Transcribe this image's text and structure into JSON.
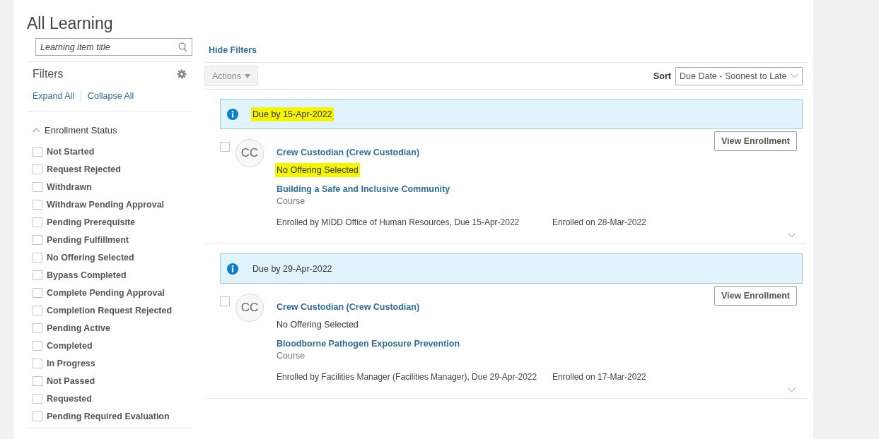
{
  "page": {
    "title": "All Learning"
  },
  "search": {
    "placeholder": "Learning item title"
  },
  "filters": {
    "title": "Filters",
    "expand_all": "Expand All",
    "collapse_all": "Collapse All",
    "sections": [
      {
        "title": "Enrollment Status",
        "expanded": true,
        "options": [
          {
            "label": "Not Started",
            "checked": false
          },
          {
            "label": "Request Rejected",
            "checked": false
          },
          {
            "label": "Withdrawn",
            "checked": false
          },
          {
            "label": "Withdraw Pending Approval",
            "checked": false
          },
          {
            "label": "Pending Prerequisite",
            "checked": false
          },
          {
            "label": "Pending Fulfillment",
            "checked": false
          },
          {
            "label": "No Offering Selected",
            "checked": false
          },
          {
            "label": "Bypass Completed",
            "checked": false
          },
          {
            "label": "Complete Pending Approval",
            "checked": false
          },
          {
            "label": "Completion Request Rejected",
            "checked": false
          },
          {
            "label": "Pending Active",
            "checked": false
          },
          {
            "label": "Completed",
            "checked": false
          },
          {
            "label": "In Progress",
            "checked": false
          },
          {
            "label": "Not Passed",
            "checked": false
          },
          {
            "label": "Requested",
            "checked": false
          },
          {
            "label": "Pending Required Evaluation",
            "checked": false
          }
        ]
      }
    ]
  },
  "hide_filters": "Hide Filters",
  "toolbar": {
    "actions": "Actions",
    "sort_label": "Sort",
    "sort_value": "Due Date - Soonest to Late"
  },
  "groups": [
    {
      "due": "Due by 15-Apr-2022",
      "highlighted": true,
      "items": [
        {
          "initials": "CC",
          "checked": false,
          "assignee": "Crew Custodian (Crew Custodian)",
          "status": "No Offering Selected",
          "status_highlighted": true,
          "title": "Building a Safe and Inclusive Community",
          "type": "Course",
          "enrolled_by": "Enrolled by MIDD Office of Human Resources, Due 15-Apr-2022",
          "enrolled_on": "Enrolled on 28-Mar-2022",
          "button": "View Enrollment",
          "expanded": false
        }
      ]
    },
    {
      "due": "Due by 29-Apr-2022",
      "highlighted": false,
      "items": [
        {
          "initials": "CC",
          "checked": false,
          "assignee": "Crew Custodian (Crew Custodian)",
          "status": "No Offering Selected",
          "status_highlighted": false,
          "title": "Bloodborne Pathogen Exposure Prevention",
          "type": "Course",
          "enrolled_by": "Enrolled by Facilities Manager (Facilities Manager), Due 29-Apr-2022",
          "enrolled_on": "Enrolled on 17-Mar-2022",
          "button": "View Enrollment",
          "expanded": false
        }
      ]
    }
  ]
}
